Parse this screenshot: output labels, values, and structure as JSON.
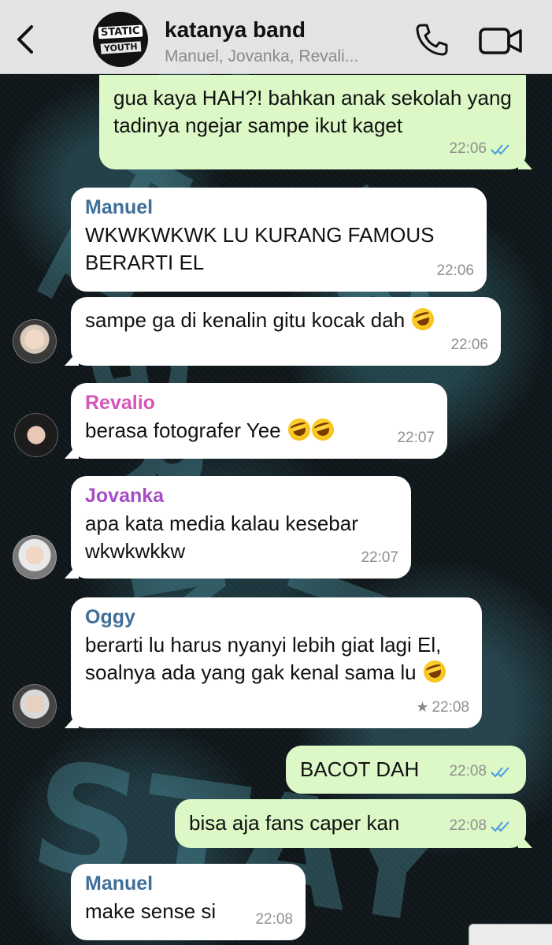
{
  "header": {
    "title": "katanya band",
    "subtitle": "Manuel, Jovanka, Revali...",
    "avatar_text_top": "STATIC",
    "avatar_text_bottom": "YOUTH"
  },
  "colors": {
    "header_bg": "#ececec",
    "bubble_in": "#ffffff",
    "bubble_out": "#dbf8c6",
    "manuel": "#3f6f98",
    "revalio": "#d555b6",
    "jovanka": "#a54dc4",
    "oggy": "#3f6f98",
    "read_ticks": "#4a9be0"
  },
  "icons": {
    "back": "chevron-left-icon",
    "call": "phone-icon",
    "video": "video-camera-icon",
    "read": "double-check-icon",
    "star": "star-icon",
    "emoji": "rofl-emoji-icon"
  },
  "messages": [
    {
      "direction": "out",
      "text": "gua kaya HAH?! bahkan anak sekolah yang tadinya ngejar sampe ikut kaget",
      "time": "22:06",
      "read": true
    },
    {
      "direction": "in",
      "sender": "Manuel",
      "text": "WKWKWKWK LU KURANG FAMOUS BERARTI EL",
      "time": "22:06"
    },
    {
      "direction": "in",
      "text": "sampe ga di kenalin gitu kocak dah",
      "emoji": "🤣",
      "time": "22:06"
    },
    {
      "direction": "in",
      "sender": "Revalio",
      "text": "berasa fotografer Yee",
      "emoji": "🤣🤣",
      "time": "22:07"
    },
    {
      "direction": "in",
      "sender": "Jovanka",
      "text": "apa kata media kalau kesebar wkwkwkkw",
      "time": "22:07"
    },
    {
      "direction": "in",
      "sender": "Oggy",
      "text": "berarti lu harus nyanyi lebih giat lagi El, soalnya ada yang gak kenal sama lu",
      "emoji": "🤣",
      "time": "22:08",
      "starred": true
    },
    {
      "direction": "out",
      "text": "BACOT DAH",
      "time": "22:08",
      "read": true
    },
    {
      "direction": "out",
      "text": "bisa aja fans caper kan",
      "time": "22:08",
      "read": true
    },
    {
      "direction": "in",
      "sender": "Manuel",
      "text": "make sense si",
      "time": "22:08"
    }
  ]
}
